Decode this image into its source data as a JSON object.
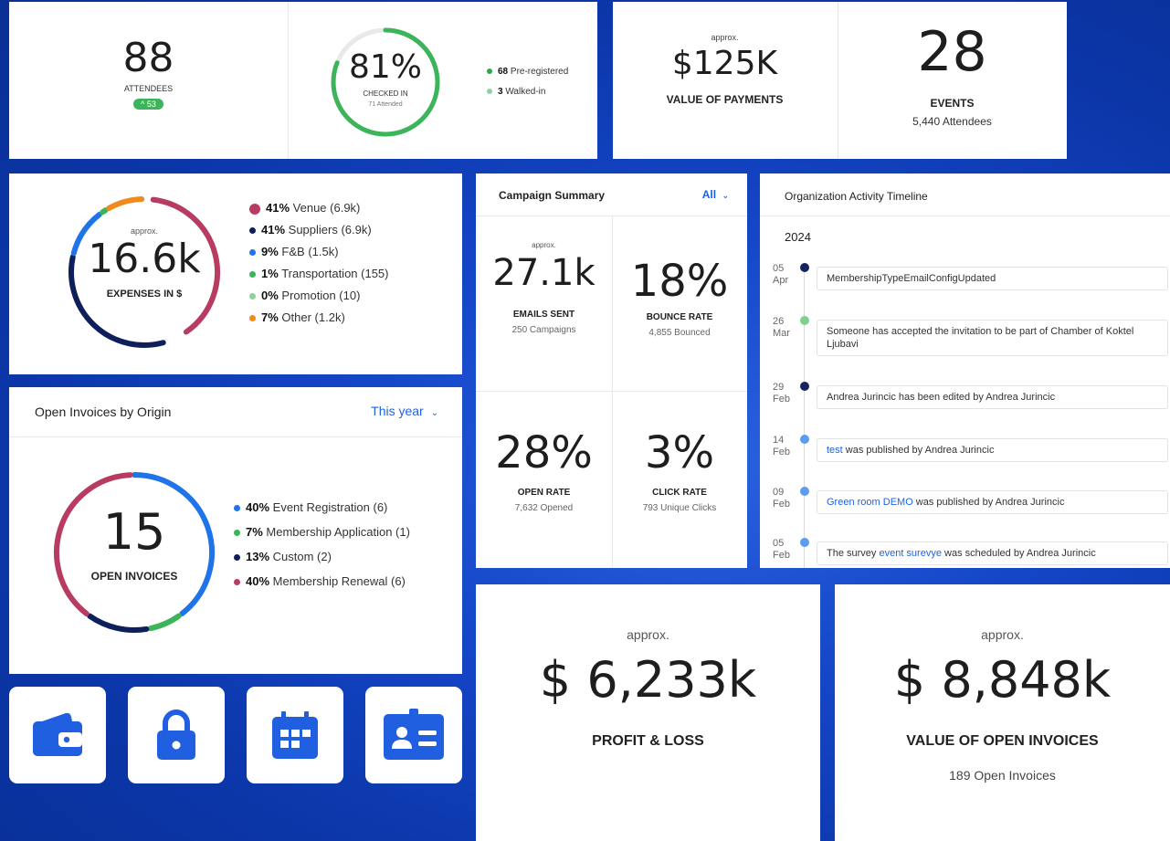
{
  "attendees": {
    "value": "88",
    "label": "ATTENDEES",
    "badge": "^ 53"
  },
  "checkin": {
    "percent_text": "81%",
    "label": "CHECKED IN",
    "sub": "71 Attended",
    "progress": 0.81,
    "legend": [
      {
        "count": "68",
        "text": "Pre-registered",
        "color": "#2aa84a"
      },
      {
        "count": "3",
        "text": "Walked-in",
        "color": "#8fd19e"
      }
    ]
  },
  "payments": {
    "approx": "approx.",
    "value": "$125K",
    "label": "VALUE OF PAYMENTS"
  },
  "events": {
    "value": "28",
    "label": "EVENTS",
    "sub": "5,440 Attendees"
  },
  "expenses": {
    "approx": "approx.",
    "value": "16.6k",
    "label": "EXPENSES IN $",
    "legend": [
      {
        "pct": "41%",
        "text": "Venue (6.9k)",
        "color": "#b83c62"
      },
      {
        "pct": "41%",
        "text": "Suppliers (6.9k)",
        "color": "#0e1f5c"
      },
      {
        "pct": "9%",
        "text": "F&B (1.5k)",
        "color": "#1f74e8"
      },
      {
        "pct": "1%",
        "text": "Transportation (155)",
        "color": "#3cb45a"
      },
      {
        "pct": "0%",
        "text": "Promotion (10)",
        "color": "#8fd19e"
      },
      {
        "pct": "7%",
        "text": "Other (1.2k)",
        "color": "#f08a1c"
      }
    ]
  },
  "invoices_origin": {
    "title": "Open Invoices by Origin",
    "filter": "This year",
    "value": "15",
    "label": "OPEN INVOICES",
    "legend": [
      {
        "pct": "40%",
        "text": "Event Registration (6)",
        "color": "#1f74e8"
      },
      {
        "pct": "7%",
        "text": "Membership Application (1)",
        "color": "#3cb45a"
      },
      {
        "pct": "13%",
        "text": "Custom (2)",
        "color": "#0e1f5c"
      },
      {
        "pct": "40%",
        "text": "Membership Renewal (6)",
        "color": "#b83c62"
      }
    ]
  },
  "campaign": {
    "title": "Campaign Summary",
    "filter": "All",
    "emails": {
      "approx": "approx.",
      "value": "27.1k",
      "label": "EMAILS SENT",
      "sub": "250 Campaigns"
    },
    "bounce": {
      "value": "18%",
      "label": "BOUNCE RATE",
      "sub": "4,855 Bounced"
    },
    "open": {
      "value": "28%",
      "label": "OPEN RATE",
      "sub": "7,632 Opened"
    },
    "click": {
      "value": "3%",
      "label": "CLICK RATE",
      "sub": "793 Unique Clicks"
    }
  },
  "timeline": {
    "title": "Organization Activity Timeline",
    "year": "2024",
    "items": [
      {
        "day": "05",
        "month": "Apr",
        "dot": "#13245e",
        "pre": "",
        "link": "",
        "text": "MembershipTypeEmailConfigUpdated"
      },
      {
        "day": "26",
        "month": "Mar",
        "dot": "#7fd08e",
        "pre": "",
        "link": "",
        "text": "Someone has accepted the invitation to be part of Chamber of Koktel Ljubavi"
      },
      {
        "day": "29",
        "month": "Feb",
        "dot": "#13245e",
        "pre": "",
        "link": "",
        "text": "Andrea Jurincic has been edited by Andrea Jurincic"
      },
      {
        "day": "14",
        "month": "Feb",
        "dot": "#5b9bf0",
        "pre": "",
        "link": "test",
        "text": " was published by Andrea Jurincic"
      },
      {
        "day": "09",
        "month": "Feb",
        "dot": "#5b9bf0",
        "pre": "",
        "link": "Green room DEMO",
        "text": " was published by Andrea Jurincic"
      },
      {
        "day": "05",
        "month": "Feb",
        "dot": "#5b9bf0",
        "pre": "The survey ",
        "link": "event surevye",
        "text": " was scheduled by Andrea Jurincic"
      }
    ]
  },
  "profit": {
    "approx": "approx.",
    "value": "$ 6,233k",
    "label": "PROFIT & LOSS"
  },
  "open_invoices_value": {
    "approx": "approx.",
    "value": "$ 8,848k",
    "label": "VALUE OF OPEN INVOICES",
    "sub": "189 Open Invoices"
  },
  "tiles": [
    {
      "icon": "wallet-icon"
    },
    {
      "icon": "lock-icon"
    },
    {
      "icon": "calendar-icon"
    },
    {
      "icon": "contact-card-icon"
    }
  ]
}
